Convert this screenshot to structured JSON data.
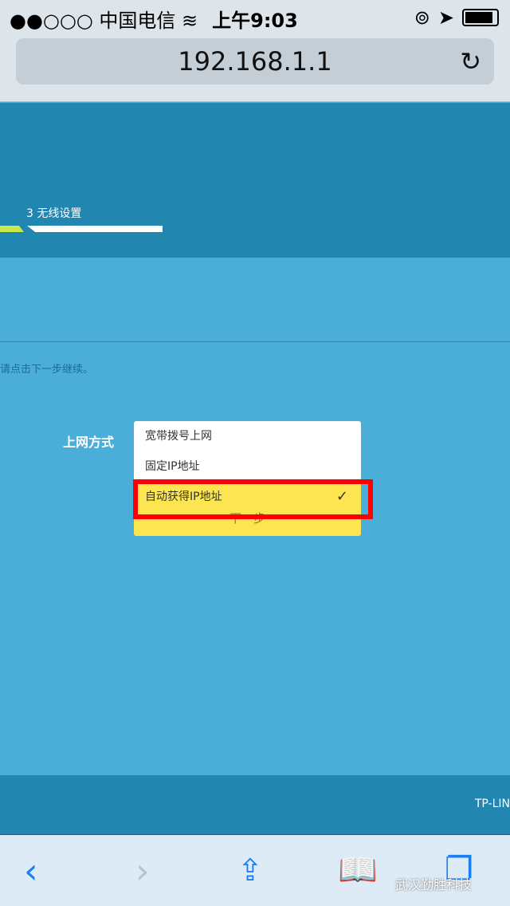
{
  "status_bar": {
    "signal": "●●○○○",
    "carrier": "中国电信",
    "time": "上午9:03"
  },
  "browser": {
    "url": "192.168.1.1"
  },
  "wizard": {
    "step_label": "3 无线设置",
    "hint": "请点击下一步继续。",
    "field_label": "上网方式",
    "next_button": "下一步",
    "options": [
      {
        "label": "宽带拨号上网",
        "selected": false
      },
      {
        "label": "固定IP地址",
        "selected": false
      },
      {
        "label": "自动获得IP地址",
        "selected": true
      }
    ]
  },
  "footer": {
    "brand": "TP-LIN"
  },
  "watermark": "武汉勤胜科技"
}
